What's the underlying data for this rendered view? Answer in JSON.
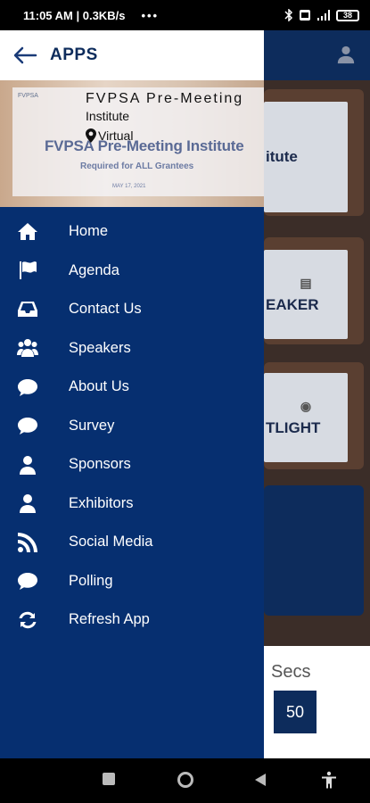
{
  "status_bar": {
    "time_speed": "11:05 AM | 0.3KB/s",
    "dots": "•••",
    "battery": "38"
  },
  "drawer": {
    "title": "APPS",
    "banner": {
      "logo_text": "FVPSA",
      "event_title": "FVPSA Pre-Meeting Institute",
      "required": "Required for ALL Grantees",
      "date": "MAY 17, 2021",
      "overlay_title": "FVPSA Pre-Meeting",
      "overlay_subtitle": "Institute",
      "location": "Virtual"
    },
    "menu": [
      {
        "label": "Home",
        "icon": "home-icon"
      },
      {
        "label": "Agenda",
        "icon": "flag-icon"
      },
      {
        "label": "Contact Us",
        "icon": "inbox-icon"
      },
      {
        "label": "Speakers",
        "icon": "users-icon"
      },
      {
        "label": "About Us",
        "icon": "chat-bubble-icon"
      },
      {
        "label": "Survey",
        "icon": "chat-bubble-icon"
      },
      {
        "label": "Sponsors",
        "icon": "user-icon"
      },
      {
        "label": "Exhibitors",
        "icon": "user-icon"
      },
      {
        "label": "Social Media",
        "icon": "rss-icon"
      },
      {
        "label": "Polling",
        "icon": "chat-bubble-icon"
      },
      {
        "label": "Refresh App",
        "icon": "refresh-icon"
      }
    ]
  },
  "background": {
    "card1_text": "itute",
    "card2_text": "EAKER",
    "card3_text": "TLIGHT",
    "secs_label": "Secs",
    "secs_value": "50"
  },
  "colors": {
    "drawer_bg": "#062f70",
    "header_bg": "#0d2c5c",
    "title_color": "#0d2c5c"
  }
}
